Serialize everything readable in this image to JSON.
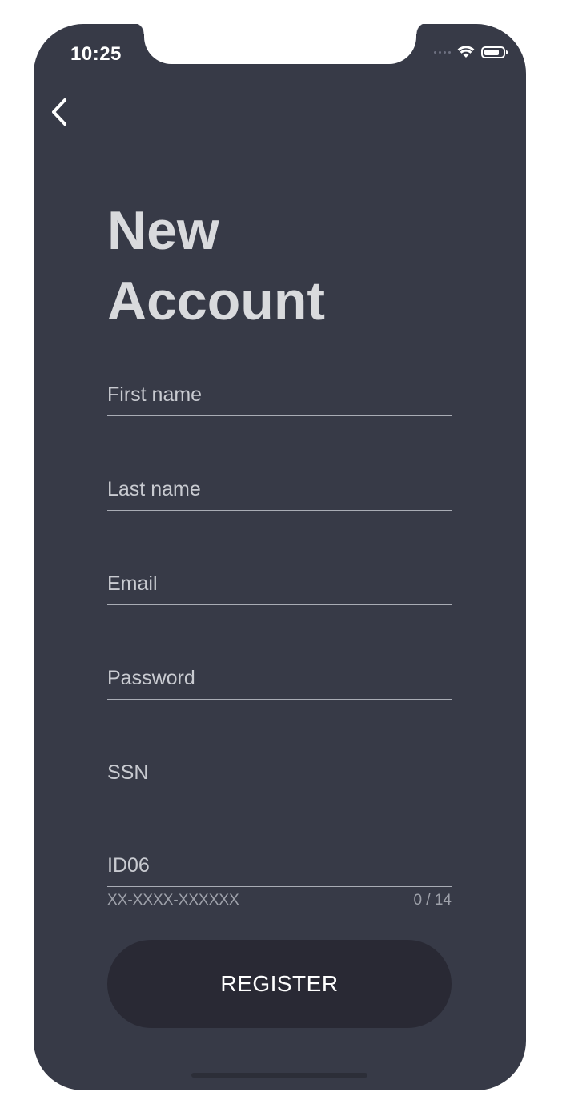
{
  "status_bar": {
    "time": "10:25",
    "icons": [
      "signal-dots-icon",
      "wifi-icon",
      "battery-icon"
    ]
  },
  "navigation": {
    "back_icon": "chevron-left-icon"
  },
  "title": {
    "line1": "New",
    "line2": "Account"
  },
  "form": {
    "first_name": {
      "placeholder": "First name",
      "value": ""
    },
    "last_name": {
      "placeholder": "Last name",
      "value": ""
    },
    "email": {
      "placeholder": "Email",
      "value": ""
    },
    "password": {
      "placeholder": "Password",
      "value": ""
    },
    "ssn": {
      "placeholder": "SSN",
      "value": ""
    },
    "id06": {
      "placeholder": "ID06",
      "value": "",
      "helper_text": "XX-XXXX-XXXXXX",
      "counter": "0 / 14"
    }
  },
  "register_button": {
    "label": "REGISTER"
  },
  "colors": {
    "background": "#373a47",
    "button": "#292934",
    "text": "#c9cbd1",
    "title": "#d9dadd"
  }
}
